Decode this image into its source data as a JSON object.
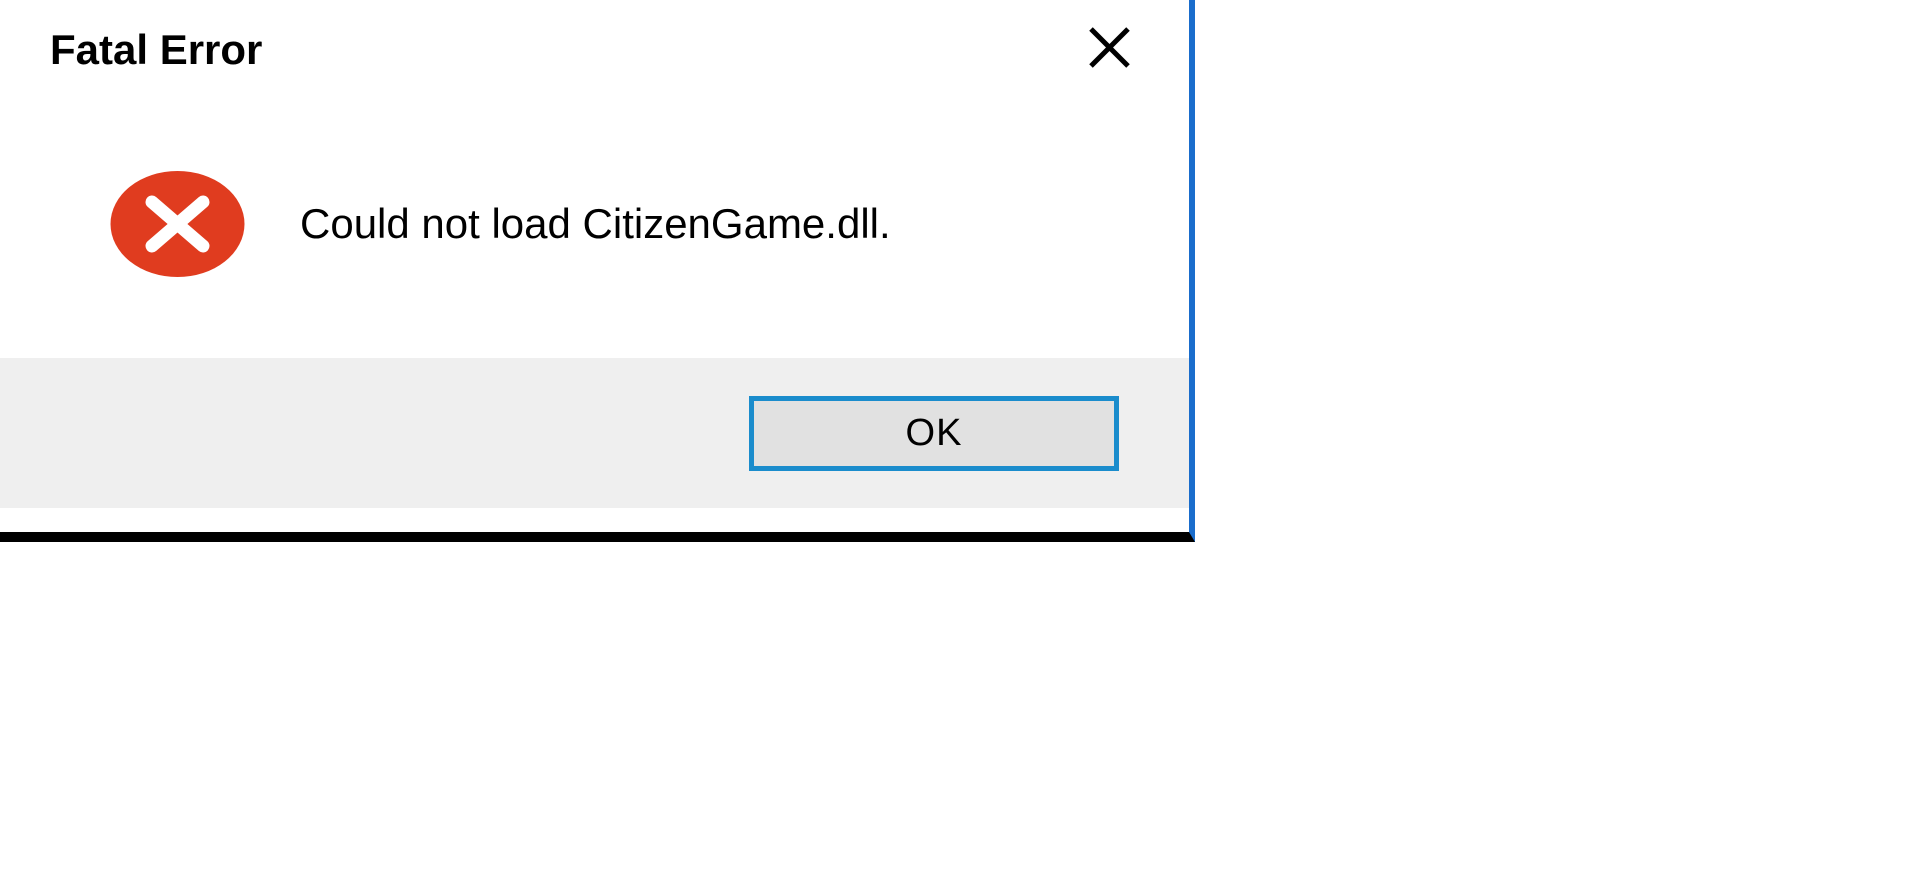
{
  "dialog": {
    "title": "Fatal Error",
    "message": "Could not load CitizenGame.dll.",
    "button_ok": "OK"
  }
}
